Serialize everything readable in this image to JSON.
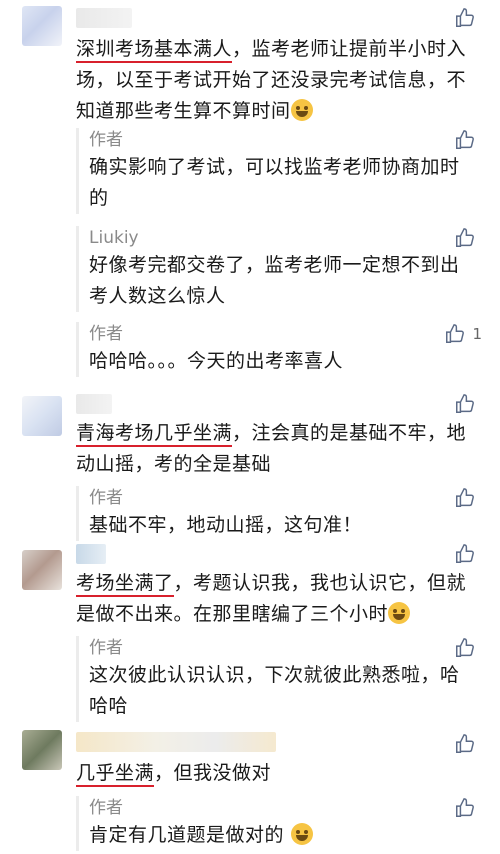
{
  "comments": [
    {
      "highlight": "深圳考场基本满人",
      "rest": "，监考老师让提前半小时入场，以至于考试开始了还没录完考试信息，不知道那些考生算不算时间",
      "emoji": "laughing-tears-emoji",
      "likes": "",
      "replies": [
        {
          "name": "作者",
          "text": "确实影响了考试，可以找监考老师协商加时的",
          "likes": ""
        },
        {
          "name": "Liukiy",
          "text": "好像考完都交卷了，监考老师一定想不到出考人数这么惊人",
          "likes": ""
        },
        {
          "name": "作者",
          "text": "哈哈哈。。。今天的出考率喜人",
          "likes": "1"
        }
      ]
    },
    {
      "highlight": "青海考场几乎坐满",
      "rest": "，注会真的是基础不牢，地动山摇，考的全是基础",
      "emoji": "",
      "likes": "",
      "replies": [
        {
          "name": "作者",
          "text": "基础不牢，地动山摇，这句准！",
          "likes": ""
        }
      ]
    },
    {
      "highlight": "考场坐满了",
      "rest": "，考题认识我，我也认识它，但就是做不出来。在那里瞎编了三个小时",
      "emoji": "crying-emoji",
      "likes": "",
      "replies": [
        {
          "name": "作者",
          "text": "这次彼此认识认识，下次就彼此熟悉啦，哈哈哈",
          "likes": ""
        }
      ]
    },
    {
      "highlight": "几乎坐满",
      "rest": "，但我没做对",
      "emoji": "",
      "likes": "",
      "replies": [
        {
          "name": "作者",
          "text": "肯定有几道题是做对的",
          "emoji": "grinning-emoji",
          "likes": ""
        }
      ]
    }
  ]
}
